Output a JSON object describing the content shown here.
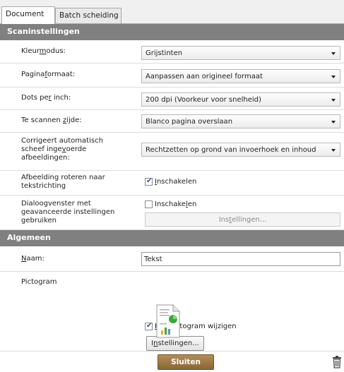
{
  "tabs": [
    {
      "label": "Document",
      "active": true
    },
    {
      "label": "Batch scheiding",
      "active": false
    }
  ],
  "scan_settings": {
    "header": "Scaninstellingen",
    "color_mode": {
      "label_pre": "Kleur",
      "label_u": "m",
      "label_post": "odus:",
      "value": "Grijstinten"
    },
    "page_size": {
      "label_pre": "Pagina",
      "label_u": "f",
      "label_post": "ormaat:",
      "value": "Aanpassen aan origineel formaat"
    },
    "dpi": {
      "label_pre": "Dots pe",
      "label_u": "r",
      "label_post": " inch:",
      "value": "200 dpi (Voorkeur voor snelheid)"
    },
    "side": {
      "label_pre": "Te scannen ",
      "label_u": "z",
      "label_post": "ijde:",
      "value": "Blanco pagina overslaan"
    },
    "deskew": {
      "label_line1": "Corrigeert automatisch",
      "label_pre": "scheef inge",
      "label_u": "v",
      "label_post": "oerde",
      "label_line3": "afbeeldingen:",
      "value": "Rechtzetten op grond van invoerhoek en inhoud"
    },
    "rotate": {
      "label_line1": "Afbeelding roteren naar",
      "label_line2": "tekstrichting",
      "check_pre": "",
      "check_u": "I",
      "check_post": "nschakelen",
      "checked": true
    },
    "advanced": {
      "label_line1": "Dialoogvenster met",
      "label_line2": "geavanceerde instellingen",
      "label_line3": "gebruiken",
      "check_pre": "Inschake",
      "check_u": "l",
      "check_post": "en",
      "checked": false,
      "button_pre": "Ins",
      "button_u": "t",
      "button_post": "ellingen..."
    }
  },
  "general": {
    "header": "Algemeen",
    "name": {
      "label_u": "N",
      "label_post": "aam:",
      "value": "Tekst"
    },
    "icon": {
      "label": "Pictogram",
      "change_u": "H",
      "change_post": "et pictogram wijzigen",
      "change_checked": true,
      "button_pre": "I",
      "button_u": "n",
      "button_post": "stellingen..."
    }
  },
  "footer": {
    "close_label": "Sluiten"
  },
  "colors": {
    "header_bg": "#808080",
    "close_bg": "#9c7845",
    "accent_green": "#3aa83a"
  }
}
